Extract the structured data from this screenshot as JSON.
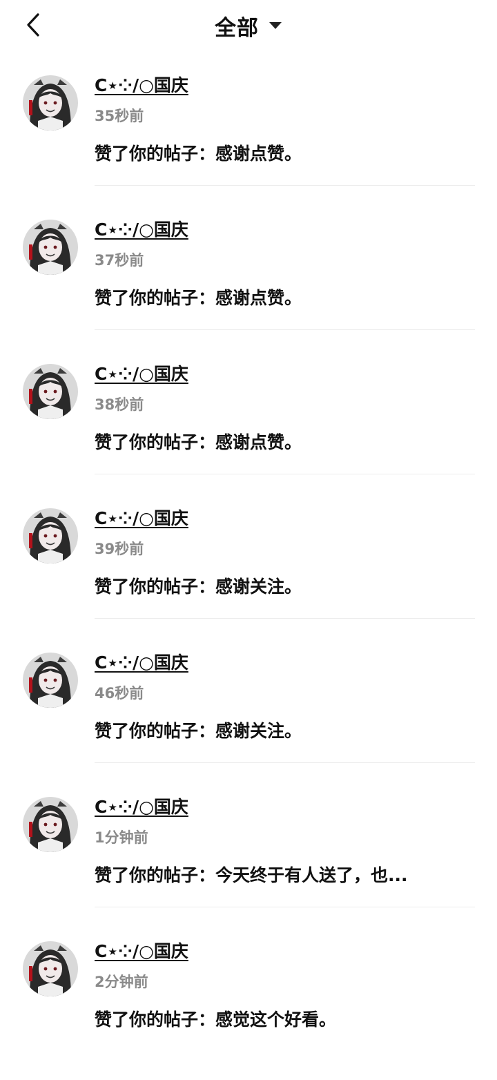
{
  "header": {
    "title": "全部",
    "back_icon": "chevron-left-icon",
    "dropdown_icon": "caret-down-icon"
  },
  "notifications": [
    {
      "user": "C⋆⁘/○国庆",
      "time": "35秒前",
      "message": "赞了你的帖子：感谢点赞。"
    },
    {
      "user": "C⋆⁘/○国庆",
      "time": "37秒前",
      "message": "赞了你的帖子：感谢点赞。"
    },
    {
      "user": "C⋆⁘/○国庆",
      "time": "38秒前",
      "message": "赞了你的帖子：感谢点赞。"
    },
    {
      "user": "C⋆⁘/○国庆",
      "time": "39秒前",
      "message": "赞了你的帖子：感谢关注。"
    },
    {
      "user": "C⋆⁘/○国庆",
      "time": "46秒前",
      "message": "赞了你的帖子：感谢关注。"
    },
    {
      "user": "C⋆⁘/○国庆",
      "time": "1分钟前",
      "message": "赞了你的帖子：今天终于有人送了，也..."
    },
    {
      "user": "C⋆⁘/○国庆",
      "time": "2分钟前",
      "message": "赞了你的帖子：感觉这个好看。"
    }
  ],
  "colors": {
    "text": "#111111",
    "muted": "#8a8a8a",
    "divider": "#ececec",
    "avatar_bg": "#d9d9d9",
    "avatar_hair": "#2a2a2a",
    "avatar_accent": "#b3121b"
  }
}
